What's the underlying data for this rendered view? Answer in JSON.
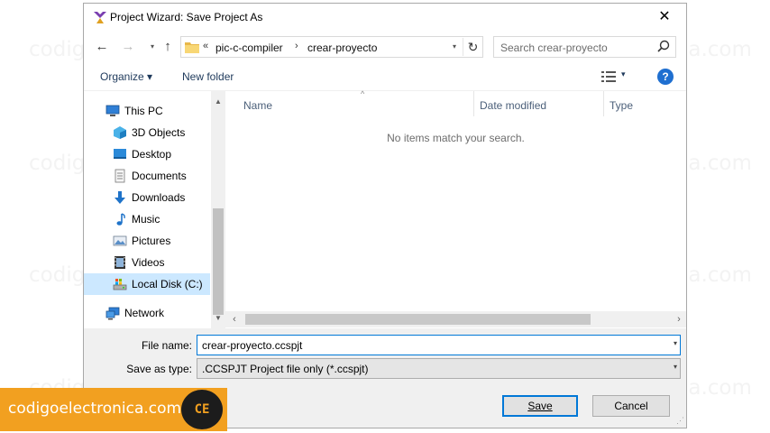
{
  "watermark": {
    "text": "codigoelectronica.com"
  },
  "window": {
    "title": "Project Wizard: Save Project As",
    "close_glyph": "✕"
  },
  "navigation": {
    "back_glyph": "←",
    "forward_glyph": "→",
    "recent_glyph": "▾",
    "up_glyph": "↑",
    "address": {
      "overflow_glyph": "«",
      "segments": [
        "pic-c-compiler",
        "crear-proyecto"
      ],
      "separator_glyph": "›",
      "dropdown_glyph": "▾",
      "refresh_glyph": "↻"
    },
    "search": {
      "placeholder": "Search crear-proyecto"
    }
  },
  "commandbar": {
    "organize": "Organize ▾",
    "new_folder": "New folder",
    "view_dropdown_glyph": "▾",
    "help_glyph": "?"
  },
  "navpane": {
    "items": [
      {
        "label": "This PC",
        "icon": "computer-icon"
      },
      {
        "label": "3D Objects",
        "icon": "3d-objects-icon"
      },
      {
        "label": "Desktop",
        "icon": "desktop-icon"
      },
      {
        "label": "Documents",
        "icon": "documents-icon"
      },
      {
        "label": "Downloads",
        "icon": "downloads-icon"
      },
      {
        "label": "Music",
        "icon": "music-icon"
      },
      {
        "label": "Pictures",
        "icon": "pictures-icon"
      },
      {
        "label": "Videos",
        "icon": "videos-icon"
      },
      {
        "label": "Local Disk (C:)",
        "icon": "local-disk-icon",
        "selected": true
      },
      {
        "label": "Network",
        "icon": "network-icon"
      }
    ],
    "scroll_up_glyph": "▲",
    "scroll_down_glyph": "▼"
  },
  "filelist": {
    "columns": [
      "Name",
      "Date modified",
      "Type"
    ],
    "sort_glyph": "^",
    "empty_message": "No items match your search.",
    "scroll_left_glyph": "‹",
    "scroll_right_glyph": "›"
  },
  "form": {
    "filename_label": "File name:",
    "filename_value": "crear-proyecto.ccspjt",
    "savetype_label": "Save as type:",
    "savetype_value": ".CCSPJT Project file only (*.ccspjt)",
    "dropdown_glyph": "▾"
  },
  "buttons": {
    "save": "Save",
    "cancel": "Cancel"
  },
  "brand": {
    "text": "codigoelectronica.com",
    "logo_text": "CE"
  },
  "colors": {
    "accent": "#0078d7",
    "selection": "#cce8ff",
    "brand_orange": "#f2a020"
  }
}
